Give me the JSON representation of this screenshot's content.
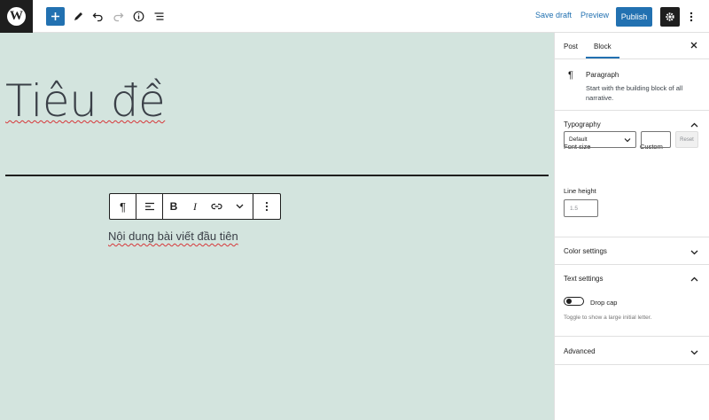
{
  "topbar": {
    "save_draft": "Save draft",
    "preview": "Preview",
    "publish": "Publish",
    "accent": "#2271b1"
  },
  "editor": {
    "title": "Tiêu đề",
    "paragraph": "Nội dung bài viết đầu tiên",
    "background": "#d3e4de"
  },
  "sidebar": {
    "tabs": [
      "Post",
      "Block"
    ],
    "active_tab": "Block",
    "block": {
      "name": "Paragraph",
      "description": "Start with the building block of all narrative."
    },
    "typography": {
      "title": "Typography",
      "font_size_label": "Font size",
      "custom_label": "Custom",
      "font_size_value": "Default",
      "reset": "Reset",
      "line_height_label": "Line height",
      "line_height_placeholder": "1.5"
    },
    "color_settings": "Color settings",
    "text_settings": {
      "title": "Text settings",
      "drop_cap": "Drop cap",
      "help": "Toggle to show a large initial letter."
    },
    "advanced": "Advanced"
  }
}
